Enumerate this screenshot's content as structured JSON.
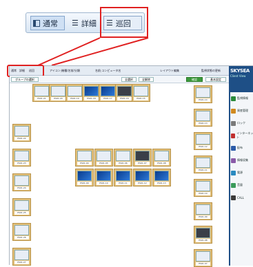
{
  "callout": {
    "normal": "通常",
    "detail": "詳細",
    "patrol": "巡回"
  },
  "toolbar": {
    "mode_normal": "通常",
    "mode_detail": "詳細",
    "mode_patrol": "巡回",
    "icon_label": "アイコン",
    "icon_value": "機種/名前/分類",
    "name_label": "名前",
    "name_value": "コンピュータ名",
    "layout_edit": "レイアウト編集",
    "monitor_state": "監視状態の更新"
  },
  "toolbar2": {
    "group": "グループの選択",
    "select_all": "全選択",
    "deselect": "全解除",
    "confirm": "確認",
    "settings": "基本設定"
  },
  "brand": {
    "name": "SKYSEA",
    "sub": "Client View"
  },
  "sidebar_menu": [
    {
      "label": "監視情報",
      "color": "#2a8a3a"
    },
    {
      "label": "資産管理",
      "color": "#d08a20"
    },
    {
      "label": "ロック",
      "color": "#7a7a7a"
    },
    {
      "label": "インターネット",
      "color": "#c03030"
    },
    {
      "label": "配布",
      "color": "#2a5aa8"
    },
    {
      "label": "情報収集",
      "color": "#8a5aa8"
    },
    {
      "label": "電源",
      "color": "#2a8ac0"
    },
    {
      "label": "音量",
      "color": "#3a9a5a"
    },
    {
      "label": "CALL",
      "color": "#3a3a3a"
    }
  ],
  "tiles_top": [
    "PS01-21",
    "PS01-20",
    "PS01-19",
    "PS01-18",
    "PS01-17",
    "PS01-16",
    "PS01-15"
  ],
  "tiles_left": [
    "PS01-22",
    "PS01-23",
    "PS01-24",
    "PS01-25",
    "PS01-26",
    "PS01-27"
  ],
  "tiles_mid_row1": [
    "PS01-04",
    "PS01-05",
    "PS01-06",
    "PS01-07",
    "PS01-08"
  ],
  "tiles_mid_row2": [
    "PS01-09",
    "PS01-10",
    "PS01-11",
    "PS01-12",
    "PS01-13"
  ],
  "tiles_right": [
    "PS01-14",
    "PS01-13",
    "PS01-12",
    "PS01-11",
    "PS01-10",
    "PS01-09",
    "PS01-08",
    "PS01-07"
  ]
}
